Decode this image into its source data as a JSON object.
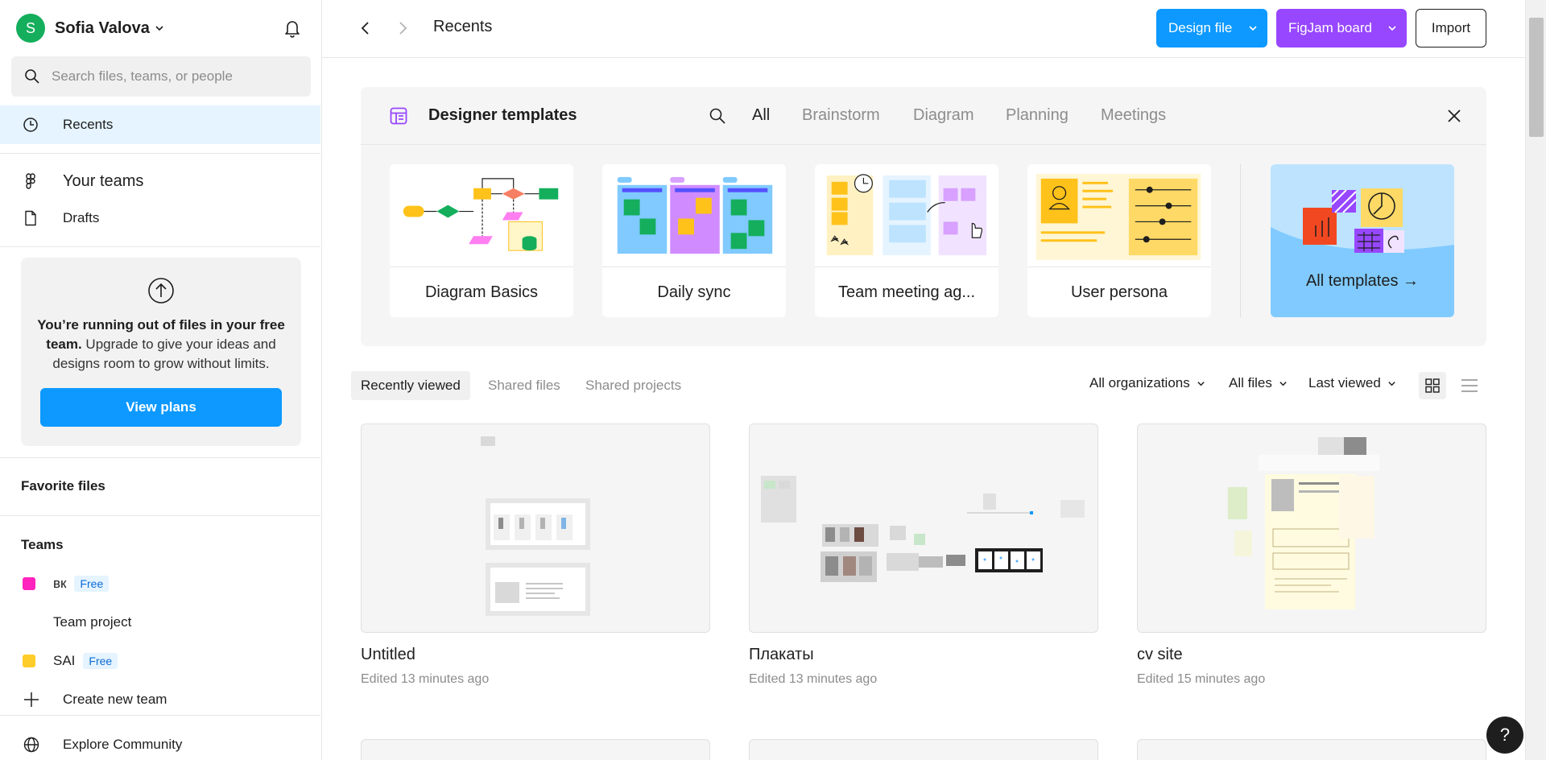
{
  "sidebar": {
    "user": {
      "initial": "S",
      "name": "Sofia Valova"
    },
    "search_placeholder": "Search files, teams, or people",
    "nav": {
      "recents": "Recents",
      "your_teams": "Your teams",
      "drafts": "Drafts"
    },
    "upgrade": {
      "bold": "You’re running out of files in your free team.",
      "text": " Upgrade to give your ideas and designs room to grow without limits.",
      "button": "View plans"
    },
    "favorite_files": "Favorite files",
    "teams_title": "Teams",
    "teams": [
      {
        "name": "вк",
        "badge": "Free",
        "color": "#ff24bd"
      },
      {
        "name": "Team project"
      },
      {
        "name": "SAI",
        "badge": "Free",
        "color": "#ffcd29"
      }
    ],
    "create_team": "Create new team",
    "explore": "Explore Community"
  },
  "header": {
    "title": "Recents",
    "design_file": "Design file",
    "figjam_board": "FigJam board",
    "import": "Import"
  },
  "templates": {
    "title": "Designer templates",
    "tabs": [
      "All",
      "Brainstorm",
      "Diagram",
      "Planning",
      "Meetings"
    ],
    "cards": [
      "Diagram Basics",
      "Daily sync",
      "Team meeting ag...",
      "User persona"
    ],
    "all_templates": "All templates →"
  },
  "filters": {
    "tabs": [
      "Recently viewed",
      "Shared files",
      "Shared projects"
    ],
    "organizations": "All organizations",
    "files": "All files",
    "sort": "Last viewed"
  },
  "files": [
    {
      "name": "Untitled",
      "meta": "Edited 13 minutes ago"
    },
    {
      "name": "Плакаты",
      "meta": "Edited 13 minutes ago"
    },
    {
      "name": "cv site",
      "meta": "Edited 15 minutes ago"
    }
  ],
  "help": "?",
  "colors": {
    "accent": "#0d99ff",
    "figjam": "#9747ff",
    "active_bg": "#e5f4ff",
    "avatar": "#14ae5c"
  }
}
